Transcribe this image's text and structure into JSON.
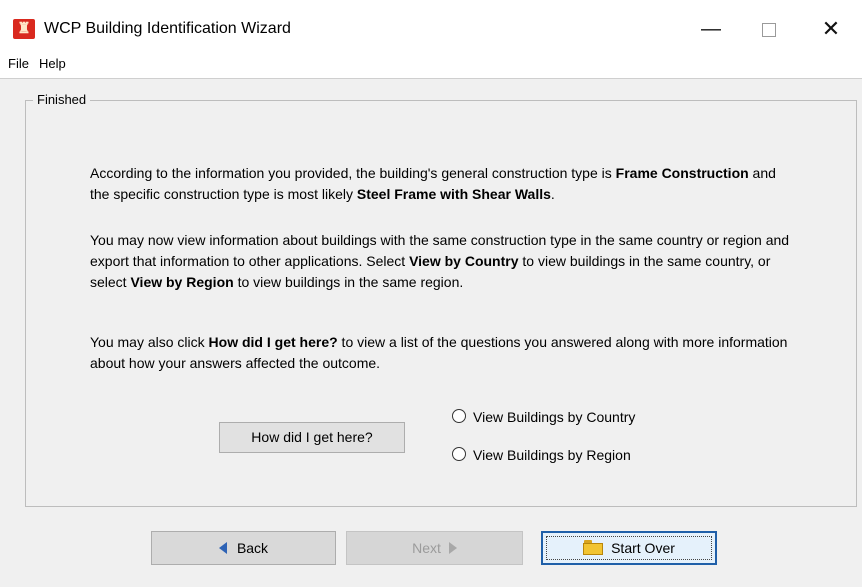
{
  "window": {
    "title": "WCP Building Identification Wizard",
    "minimize_glyph": "—",
    "close_glyph": "✕"
  },
  "menu": {
    "file": "File",
    "help": "Help"
  },
  "panel": {
    "legend": "Finished",
    "p1": {
      "a": "According to the information you provided, the building's general construction type is ",
      "b": "Frame Construction",
      "c": " and the specific construction type is most likely ",
      "d": "Steel Frame with Shear Walls",
      "e": "."
    },
    "p2": {
      "a": "You may now view information about buildings with the same construction type in the same country or region and export that information to other applications. Select ",
      "b": "View by Country",
      "c": " to view buildings in the same country, or select ",
      "d": "View by Region",
      "e": " to view buildings in the same region."
    },
    "p3": {
      "a": "You may also click ",
      "b": "How did I get here?",
      "c": " to view a list of the questions you answered along with more information about how your answers affected the outcome."
    },
    "how_button": "How did I get here?",
    "radio_country": "View Buildings by Country",
    "radio_region": "View Buildings by Region"
  },
  "footer": {
    "back": "Back",
    "next": "Next",
    "start_over": "Start Over"
  },
  "icons": {
    "app": "app-logo-icon",
    "back": "arrow-left-icon",
    "next": "arrow-right-icon",
    "start_over": "folder-icon"
  },
  "colors": {
    "app_icon": "#d9291e",
    "back_arrow": "#2e63b5",
    "focus_border": "#1f5fa8"
  }
}
